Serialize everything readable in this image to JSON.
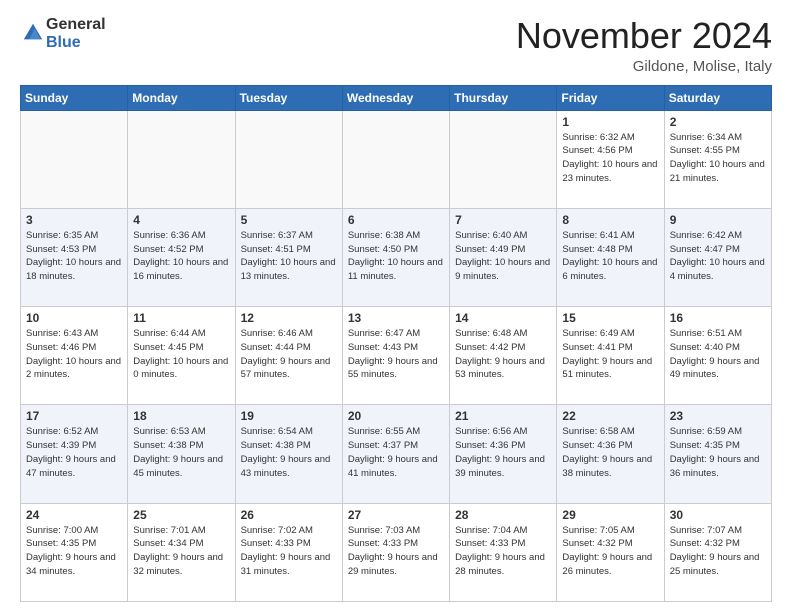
{
  "header": {
    "logo_general": "General",
    "logo_blue": "Blue",
    "month_title": "November 2024",
    "location": "Gildone, Molise, Italy"
  },
  "days_of_week": [
    "Sunday",
    "Monday",
    "Tuesday",
    "Wednesday",
    "Thursday",
    "Friday",
    "Saturday"
  ],
  "weeks": [
    [
      {
        "day": "",
        "info": ""
      },
      {
        "day": "",
        "info": ""
      },
      {
        "day": "",
        "info": ""
      },
      {
        "day": "",
        "info": ""
      },
      {
        "day": "",
        "info": ""
      },
      {
        "day": "1",
        "info": "Sunrise: 6:32 AM\nSunset: 4:56 PM\nDaylight: 10 hours and 23 minutes."
      },
      {
        "day": "2",
        "info": "Sunrise: 6:34 AM\nSunset: 4:55 PM\nDaylight: 10 hours and 21 minutes."
      }
    ],
    [
      {
        "day": "3",
        "info": "Sunrise: 6:35 AM\nSunset: 4:53 PM\nDaylight: 10 hours and 18 minutes."
      },
      {
        "day": "4",
        "info": "Sunrise: 6:36 AM\nSunset: 4:52 PM\nDaylight: 10 hours and 16 minutes."
      },
      {
        "day": "5",
        "info": "Sunrise: 6:37 AM\nSunset: 4:51 PM\nDaylight: 10 hours and 13 minutes."
      },
      {
        "day": "6",
        "info": "Sunrise: 6:38 AM\nSunset: 4:50 PM\nDaylight: 10 hours and 11 minutes."
      },
      {
        "day": "7",
        "info": "Sunrise: 6:40 AM\nSunset: 4:49 PM\nDaylight: 10 hours and 9 minutes."
      },
      {
        "day": "8",
        "info": "Sunrise: 6:41 AM\nSunset: 4:48 PM\nDaylight: 10 hours and 6 minutes."
      },
      {
        "day": "9",
        "info": "Sunrise: 6:42 AM\nSunset: 4:47 PM\nDaylight: 10 hours and 4 minutes."
      }
    ],
    [
      {
        "day": "10",
        "info": "Sunrise: 6:43 AM\nSunset: 4:46 PM\nDaylight: 10 hours and 2 minutes."
      },
      {
        "day": "11",
        "info": "Sunrise: 6:44 AM\nSunset: 4:45 PM\nDaylight: 10 hours and 0 minutes."
      },
      {
        "day": "12",
        "info": "Sunrise: 6:46 AM\nSunset: 4:44 PM\nDaylight: 9 hours and 57 minutes."
      },
      {
        "day": "13",
        "info": "Sunrise: 6:47 AM\nSunset: 4:43 PM\nDaylight: 9 hours and 55 minutes."
      },
      {
        "day": "14",
        "info": "Sunrise: 6:48 AM\nSunset: 4:42 PM\nDaylight: 9 hours and 53 minutes."
      },
      {
        "day": "15",
        "info": "Sunrise: 6:49 AM\nSunset: 4:41 PM\nDaylight: 9 hours and 51 minutes."
      },
      {
        "day": "16",
        "info": "Sunrise: 6:51 AM\nSunset: 4:40 PM\nDaylight: 9 hours and 49 minutes."
      }
    ],
    [
      {
        "day": "17",
        "info": "Sunrise: 6:52 AM\nSunset: 4:39 PM\nDaylight: 9 hours and 47 minutes."
      },
      {
        "day": "18",
        "info": "Sunrise: 6:53 AM\nSunset: 4:38 PM\nDaylight: 9 hours and 45 minutes."
      },
      {
        "day": "19",
        "info": "Sunrise: 6:54 AM\nSunset: 4:38 PM\nDaylight: 9 hours and 43 minutes."
      },
      {
        "day": "20",
        "info": "Sunrise: 6:55 AM\nSunset: 4:37 PM\nDaylight: 9 hours and 41 minutes."
      },
      {
        "day": "21",
        "info": "Sunrise: 6:56 AM\nSunset: 4:36 PM\nDaylight: 9 hours and 39 minutes."
      },
      {
        "day": "22",
        "info": "Sunrise: 6:58 AM\nSunset: 4:36 PM\nDaylight: 9 hours and 38 minutes."
      },
      {
        "day": "23",
        "info": "Sunrise: 6:59 AM\nSunset: 4:35 PM\nDaylight: 9 hours and 36 minutes."
      }
    ],
    [
      {
        "day": "24",
        "info": "Sunrise: 7:00 AM\nSunset: 4:35 PM\nDaylight: 9 hours and 34 minutes."
      },
      {
        "day": "25",
        "info": "Sunrise: 7:01 AM\nSunset: 4:34 PM\nDaylight: 9 hours and 32 minutes."
      },
      {
        "day": "26",
        "info": "Sunrise: 7:02 AM\nSunset: 4:33 PM\nDaylight: 9 hours and 31 minutes."
      },
      {
        "day": "27",
        "info": "Sunrise: 7:03 AM\nSunset: 4:33 PM\nDaylight: 9 hours and 29 minutes."
      },
      {
        "day": "28",
        "info": "Sunrise: 7:04 AM\nSunset: 4:33 PM\nDaylight: 9 hours and 28 minutes."
      },
      {
        "day": "29",
        "info": "Sunrise: 7:05 AM\nSunset: 4:32 PM\nDaylight: 9 hours and 26 minutes."
      },
      {
        "day": "30",
        "info": "Sunrise: 7:07 AM\nSunset: 4:32 PM\nDaylight: 9 hours and 25 minutes."
      }
    ]
  ]
}
